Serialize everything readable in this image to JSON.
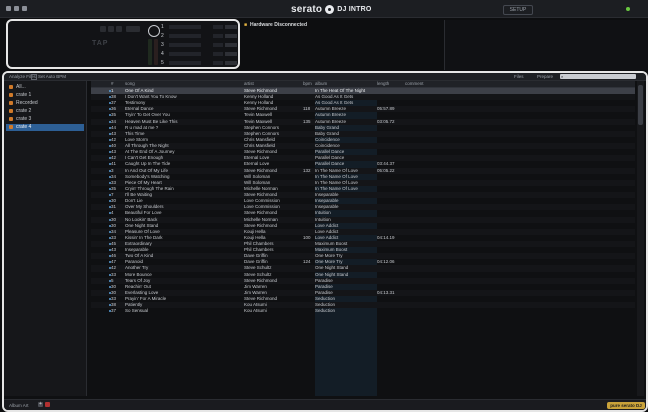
{
  "topbar": {
    "brand": "serato",
    "product": "DJ INTRO",
    "setup_label": "SETUP",
    "status_color": "#69c840"
  },
  "deck": {
    "tap_label": "TAP",
    "cues": [
      "1",
      "2",
      "3",
      "4",
      "5"
    ]
  },
  "status": {
    "message": "Hardware Disconnected"
  },
  "browser": {
    "analyze_label": "Analyze Files",
    "autobpm_label": "Set Auto BPM",
    "filter_label": "Files",
    "prepare_label": "Prepare",
    "search_placeholder": ""
  },
  "sidebar": {
    "items": [
      {
        "label": "All...",
        "selected": false
      },
      {
        "label": "crate 1",
        "selected": false
      },
      {
        "label": "Recorded",
        "selected": false
      },
      {
        "label": "crate 2",
        "selected": false
      },
      {
        "label": "crate 3",
        "selected": false
      },
      {
        "label": "crate 4",
        "selected": true
      }
    ]
  },
  "columns": [
    "#",
    "song",
    "artist",
    "bpm",
    "album",
    "length",
    "comment"
  ],
  "tracks": [
    [
      "1",
      "One Of A Kind",
      "Steve Richmond",
      "",
      "In The Heat Of The Night",
      ""
    ],
    [
      "38",
      "I Don't Want You To Know",
      "Kenny Holland",
      "",
      "As Good As It Gets",
      ""
    ],
    [
      "37",
      "Testimony",
      "Kenny Holland",
      "",
      "As Good As It Gets",
      ""
    ],
    [
      "36",
      "Eternal Dance",
      "Steve Richmond",
      "118",
      "Autumn Breeze",
      "05:57.89"
    ],
    [
      "35",
      "Tryin' To Get Over You",
      "Tevin Maxwell",
      "",
      "Autumn Breeze",
      ""
    ],
    [
      "34",
      "Heaven Must Be Like This",
      "Tevin Maxwell",
      "135",
      "Autumn Breeze",
      "03:05.72"
    ],
    [
      "44",
      "R u mad at me ?",
      "Stephen Connors",
      "",
      "Baby Grand",
      ""
    ],
    [
      "43",
      "This Time",
      "Stephen Connors",
      "",
      "Baby Grand",
      ""
    ],
    [
      "42",
      "Love Storm",
      "Chris Mansfield",
      "",
      "Coincidence",
      ""
    ],
    [
      "40",
      "All Through The Night",
      "Chris Mansfield",
      "",
      "Coincidence",
      ""
    ],
    [
      "43",
      "At The End Of A Journey",
      "Steve Richmond",
      "",
      "Parallel Dance",
      ""
    ],
    [
      "42",
      "I Can't Get Enough",
      "Eternal Love",
      "",
      "Parallel Dance",
      ""
    ],
    [
      "41",
      "Caught Up In The Tide",
      "Eternal Love",
      "",
      "Parallel Dance",
      "03:44.37"
    ],
    [
      "3",
      "In And Out Of My Life",
      "Steve Richmond",
      "132",
      "In The Name Of Love",
      "05:05.22"
    ],
    [
      "34",
      "Somebody's Watching",
      "Will Soloman",
      "",
      "In The Name Of Love",
      ""
    ],
    [
      "33",
      "Piece Of My Heart",
      "Will Soloman",
      "",
      "In The Name Of Love",
      ""
    ],
    [
      "35",
      "Cryin' Through The Rain",
      "Michelle Norman",
      "",
      "In The Name Of Love",
      ""
    ],
    [
      "7",
      "I'll Be Waiting",
      "Steve Richmond",
      "",
      "Inseparable",
      ""
    ],
    [
      "30",
      "Don't Lie",
      "Love Commission",
      "",
      "Inseparable",
      ""
    ],
    [
      "31",
      "Over My Shoulders",
      "Love Commission",
      "",
      "Inseparable",
      ""
    ],
    [
      "4",
      "Beautiful For Love",
      "Steve Richmond",
      "",
      "Intuition",
      ""
    ],
    [
      "30",
      "No Lookin' Back",
      "Michelle Norman",
      "",
      "Intuition",
      ""
    ],
    [
      "30",
      "One Night Stand",
      "Steve Richmond",
      "",
      "Love Addict",
      ""
    ],
    [
      "34",
      "Pleasure Of Love",
      "Kouji Hella",
      "",
      "Love Addict",
      ""
    ],
    [
      "33",
      "Kissin' In The Dark",
      "Kouji Hella",
      "100",
      "Love Addict",
      "04:14.19"
    ],
    [
      "45",
      "Extraordinary",
      "Phil Chambers",
      "",
      "Maximum Boost",
      ""
    ],
    [
      "43",
      "Inseparable",
      "Phil Chambers",
      "",
      "Maximum Boost",
      ""
    ],
    [
      "46",
      "Two Of A Kind",
      "Dave Griffin",
      "",
      "One More Try",
      ""
    ],
    [
      "47",
      "Paranoid",
      "Dave Griffin",
      "124",
      "One More Try",
      "04:12.06"
    ],
    [
      "42",
      "Another Try",
      "Steve Schultz",
      "",
      "One Night Stand",
      ""
    ],
    [
      "33",
      "More Bounce",
      "Steve Schultz",
      "",
      "One Night Stand",
      ""
    ],
    [
      "5",
      "Tears Of Joy",
      "Steve Richmond",
      "",
      "Paradise",
      ""
    ],
    [
      "30",
      "Reachin' Out",
      "Jim Warren",
      "",
      "Paradise",
      ""
    ],
    [
      "30",
      "Everlasting Love",
      "Jim Warren",
      "",
      "Paradise",
      "04:13.31"
    ],
    [
      "33",
      "Prayin' For A Miracle",
      "Steve Richmond",
      "",
      "Seduction",
      ""
    ],
    [
      "38",
      "Patiently",
      "Kou Atsumi",
      "",
      "Seduction",
      ""
    ],
    [
      "37",
      "So Sensual",
      "Kou Atsumi",
      "",
      "Seduction",
      ""
    ]
  ],
  "bottom": {
    "album_art_label": "Album Art",
    "brand_label": "pure serato DJ INTRO"
  }
}
